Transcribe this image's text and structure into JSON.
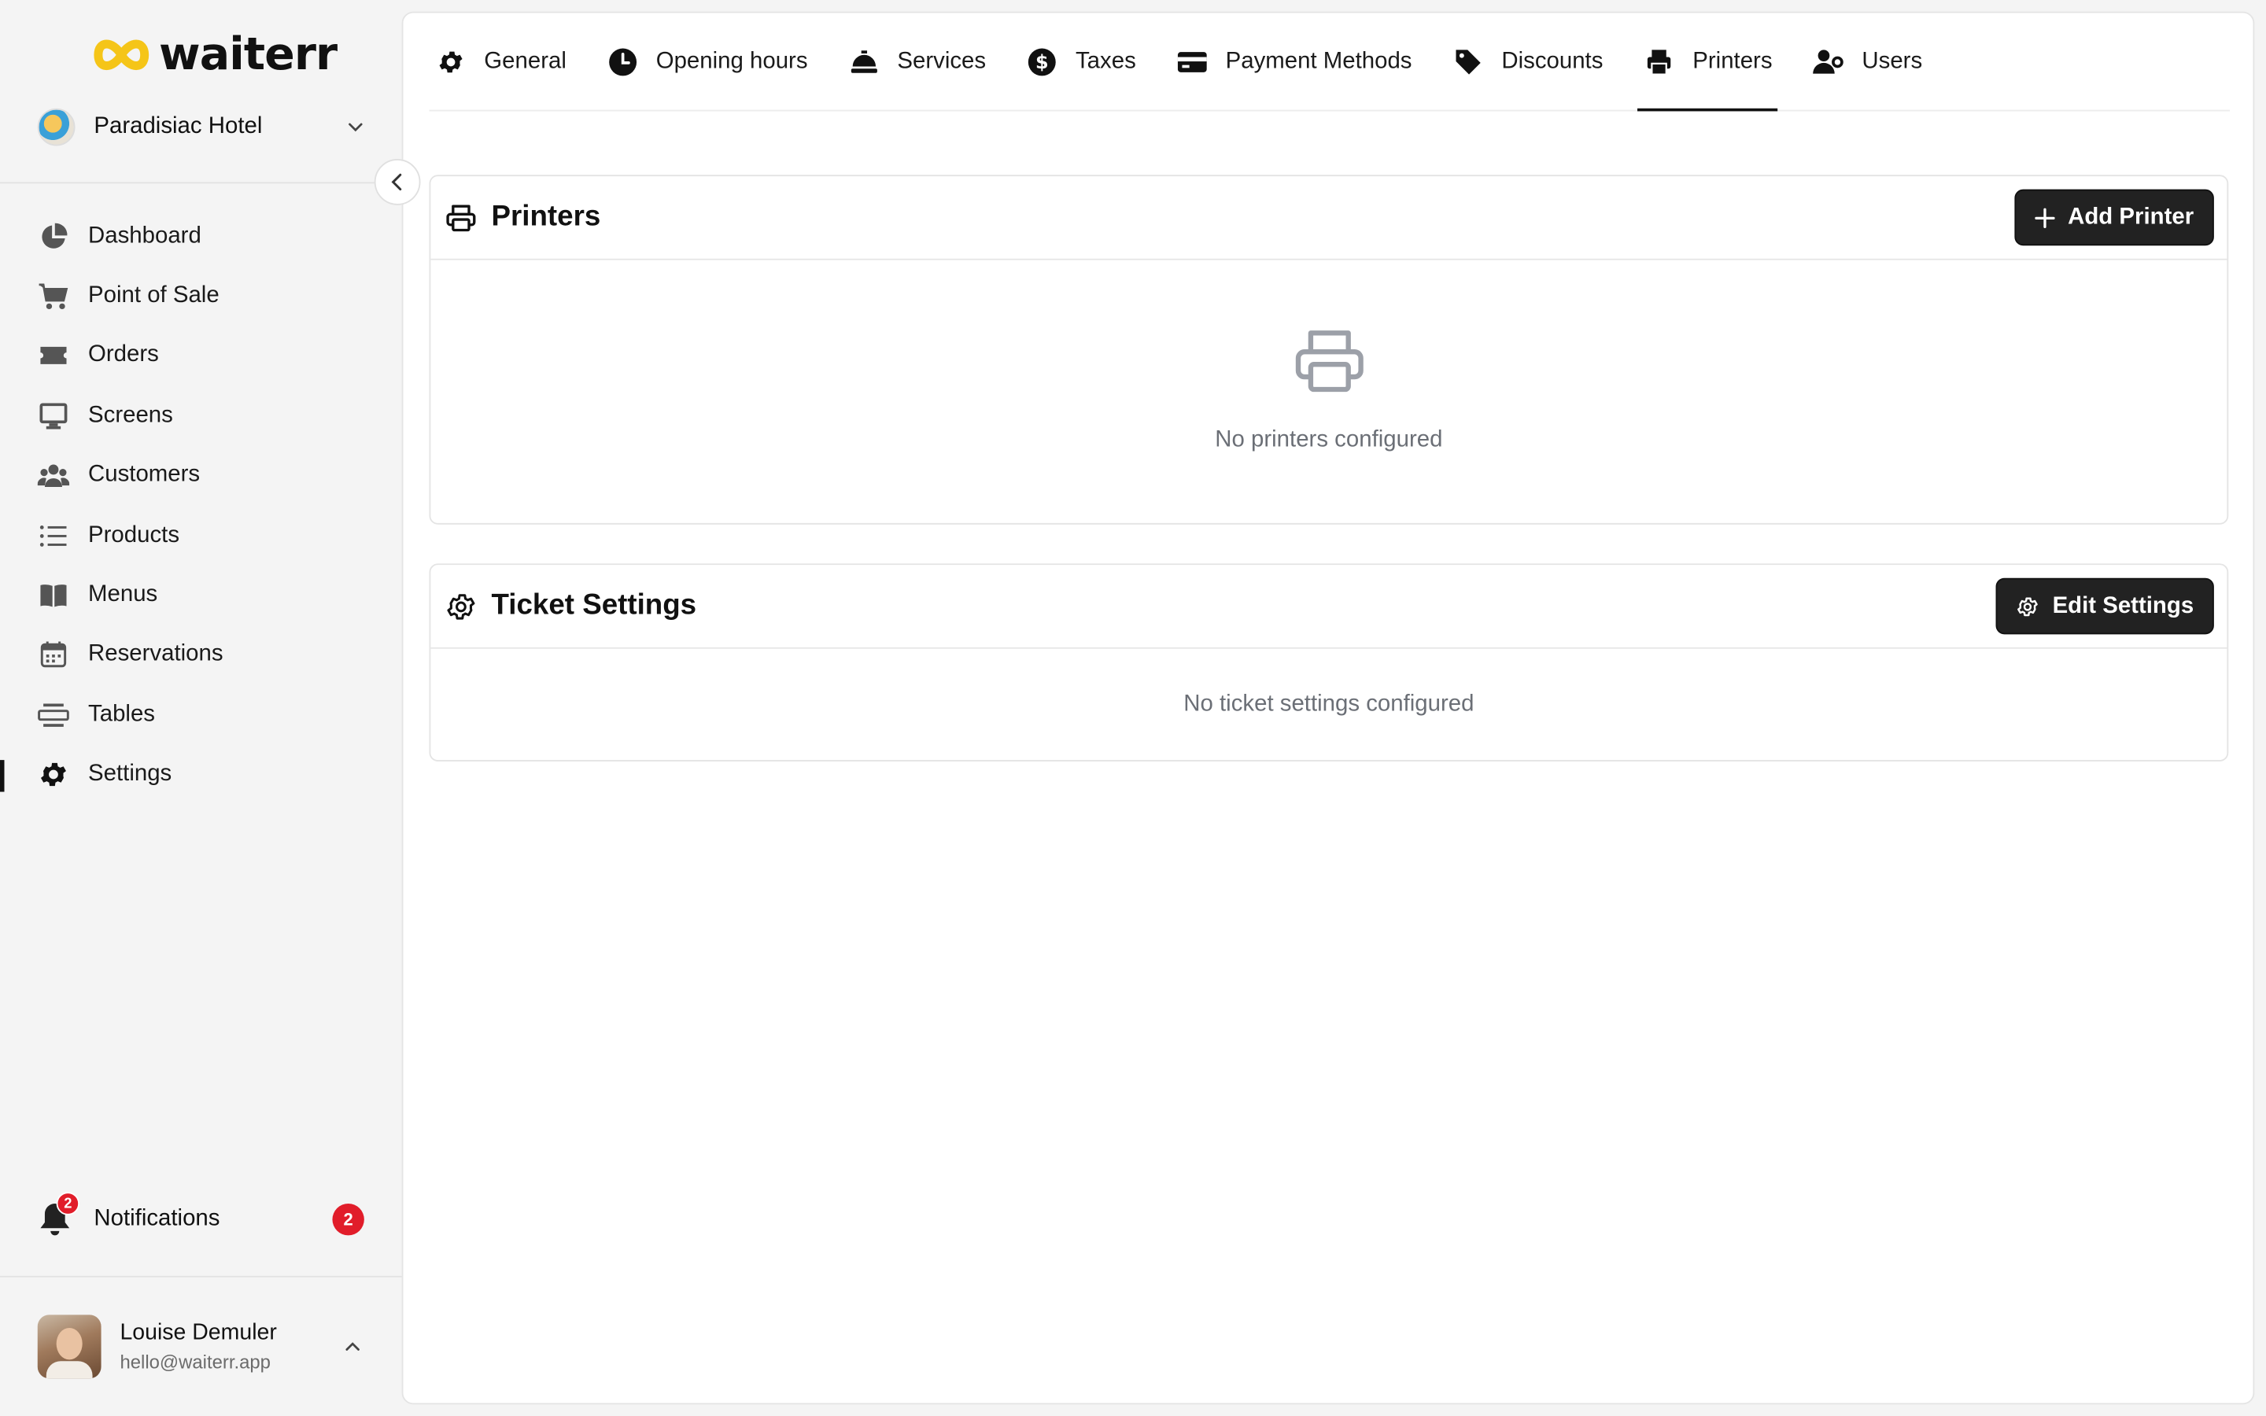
{
  "brand": {
    "name": "waiterr"
  },
  "venue": {
    "name": "Paradisiac Hotel"
  },
  "sidebar": {
    "items": [
      {
        "label": "Dashboard",
        "icon": "pie-chart-icon"
      },
      {
        "label": "Point of Sale",
        "icon": "cart-icon"
      },
      {
        "label": "Orders",
        "icon": "ticket-icon"
      },
      {
        "label": "Screens",
        "icon": "monitor-icon"
      },
      {
        "label": "Customers",
        "icon": "users-icon"
      },
      {
        "label": "Products",
        "icon": "list-icon"
      },
      {
        "label": "Menus",
        "icon": "book-icon"
      },
      {
        "label": "Reservations",
        "icon": "calendar-icon"
      },
      {
        "label": "Tables",
        "icon": "table-icon"
      },
      {
        "label": "Settings",
        "icon": "gear-icon",
        "active": true
      }
    ],
    "notifications": {
      "label": "Notifications",
      "count": "2"
    },
    "user": {
      "name": "Louise Demuler",
      "email": "hello@waiterr.app"
    }
  },
  "tabs": [
    {
      "label": "General",
      "icon": "gear-icon"
    },
    {
      "label": "Opening hours",
      "icon": "clock-icon"
    },
    {
      "label": "Services",
      "icon": "cloche-icon"
    },
    {
      "label": "Taxes",
      "icon": "dollar-icon"
    },
    {
      "label": "Payment Methods",
      "icon": "credit-card-icon"
    },
    {
      "label": "Discounts",
      "icon": "tag-icon"
    },
    {
      "label": "Printers",
      "icon": "printer-icon",
      "active": true
    },
    {
      "label": "Users",
      "icon": "user-gear-icon"
    }
  ],
  "printers_card": {
    "title": "Printers",
    "button": "Add Printer",
    "empty_text": "No printers configured"
  },
  "ticket_card": {
    "title": "Ticket Settings",
    "button": "Edit Settings",
    "empty_text": "No ticket settings configured"
  },
  "colors": {
    "accent": "#111111",
    "logo_yellow": "#f5c518",
    "badge_red": "#e11d2a",
    "muted_text": "#6b6f76"
  }
}
